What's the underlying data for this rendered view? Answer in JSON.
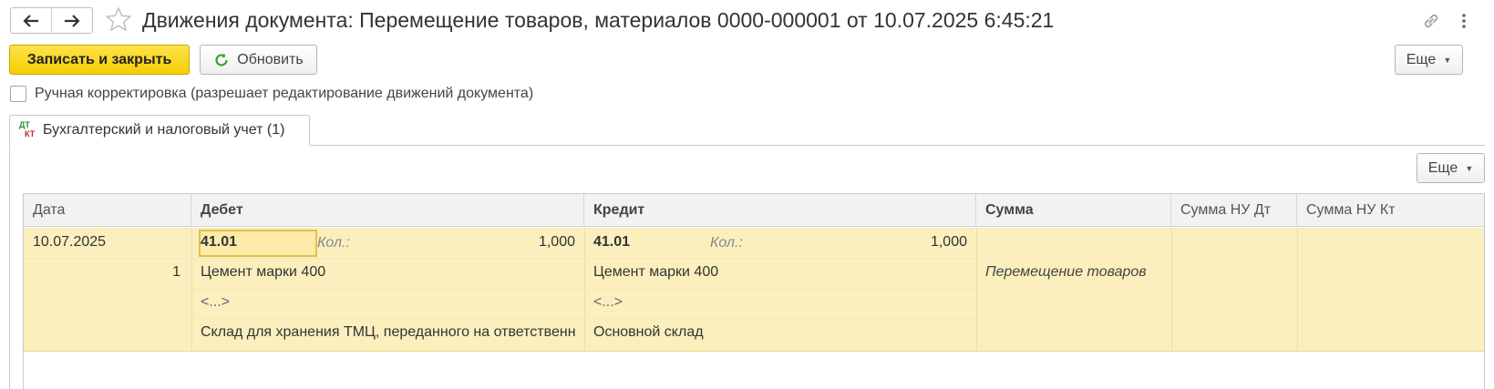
{
  "window": {
    "title": "Движения документа: Перемещение товаров, материалов 0000-000001 от 10.07.2025 6:45:21",
    "icons": [
      "arrow-left-icon",
      "arrow-right-icon",
      "star-icon",
      "link-icon",
      "kebab-icon"
    ]
  },
  "toolbar": {
    "save_close_label": "Записать и закрыть",
    "refresh_label": "Обновить",
    "more_label": "Еще"
  },
  "manual_correction": {
    "label": "Ручная корректировка (разрешает редактирование движений документа)",
    "checked": false
  },
  "tabs": [
    {
      "icon_top": "ДТ",
      "icon_bottom": "КТ",
      "label": "Бухгалтерский и налоговый учет (1)"
    }
  ],
  "panel": {
    "more_label": "Еще"
  },
  "grid": {
    "columns": [
      "Дата",
      "Дебет",
      "Кредит",
      "Сумма",
      "Сумма НУ Дт",
      "Сумма НУ Кт"
    ],
    "rows": [
      {
        "date": "10.07.2025",
        "line_number": "1",
        "debit_account": "41.01",
        "debit_qty_label": "Кол.:",
        "debit_qty": "1,000",
        "debit_subconto1": "Цемент марки 400",
        "debit_subconto2": "<...>",
        "debit_subconto3": "Склад для хранения ТМЦ, переданного на ответственн",
        "credit_account": "41.01",
        "credit_qty_label": "Кол.:",
        "credit_qty": "1,000",
        "credit_subconto1": "Цемент марки 400",
        "credit_subconto2": "<...>",
        "credit_subconto3": "Основной склад",
        "amount": "",
        "content": "Перемещение товаров",
        "amount_nu_dt": "",
        "amount_nu_kt": ""
      }
    ]
  },
  "colors": {
    "accent_yellow": "#f5cd00",
    "selected_row": "#fbefbe",
    "refresh_icon": "#3aa13a"
  }
}
